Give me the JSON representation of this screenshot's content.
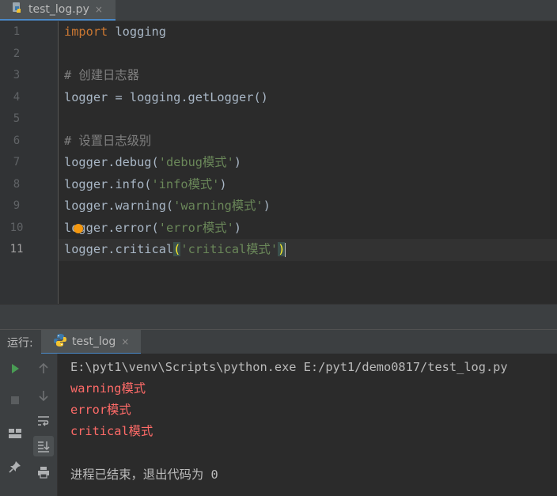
{
  "editor_tab": {
    "filename": "test_log.py",
    "close_glyph": "×"
  },
  "editor": {
    "line_numbers": [
      "1",
      "2",
      "3",
      "4",
      "5",
      "6",
      "7",
      "8",
      "9",
      "10",
      "11"
    ],
    "lines": {
      "l1_kw": "import",
      "l1_rest": " logging",
      "l3_comment": "# 创建日志器",
      "l4": "logger = logging.getLogger()",
      "l6_comment": "# 设置日志级别",
      "l7_call": "logger.debug(",
      "l7_str": "'debug模式'",
      "l7_end": ")",
      "l8_call": "logger.info(",
      "l8_str": "'info模式'",
      "l8_end": ")",
      "l9_call": "logger.warning(",
      "l9_str": "'warning模式'",
      "l9_end": ")",
      "l10_call": "logger.error(",
      "l10_str": "'error模式'",
      "l10_end": ")",
      "l11_call": "logger.critical",
      "l11_open": "(",
      "l11_str": "'critical模式'",
      "l11_close": ")"
    }
  },
  "run_panel": {
    "title": "运行:",
    "tab_label": "test_log",
    "close_glyph": "×",
    "console": {
      "command": "E:\\pyt1\\venv\\Scripts\\python.exe E:/pyt1/demo0817/test_log.py",
      "output": [
        "warning模式",
        "error模式",
        "critical模式"
      ],
      "exit_message": "进程已结束，退出代码为 0"
    },
    "tools_left": [
      "run-icon",
      "stop-icon",
      "layout-icon",
      "pin-icon"
    ],
    "tools_right": [
      "arrow-up-icon",
      "arrow-down-icon",
      "soft-wrap-icon",
      "scroll-to-end-icon",
      "print-icon"
    ]
  },
  "colors": {
    "background": "#2b2b2b",
    "keyword": "#cc7832",
    "string": "#6a8759",
    "comment": "#808080",
    "stderr": "#ff6b68",
    "run_green": "#499c54"
  }
}
